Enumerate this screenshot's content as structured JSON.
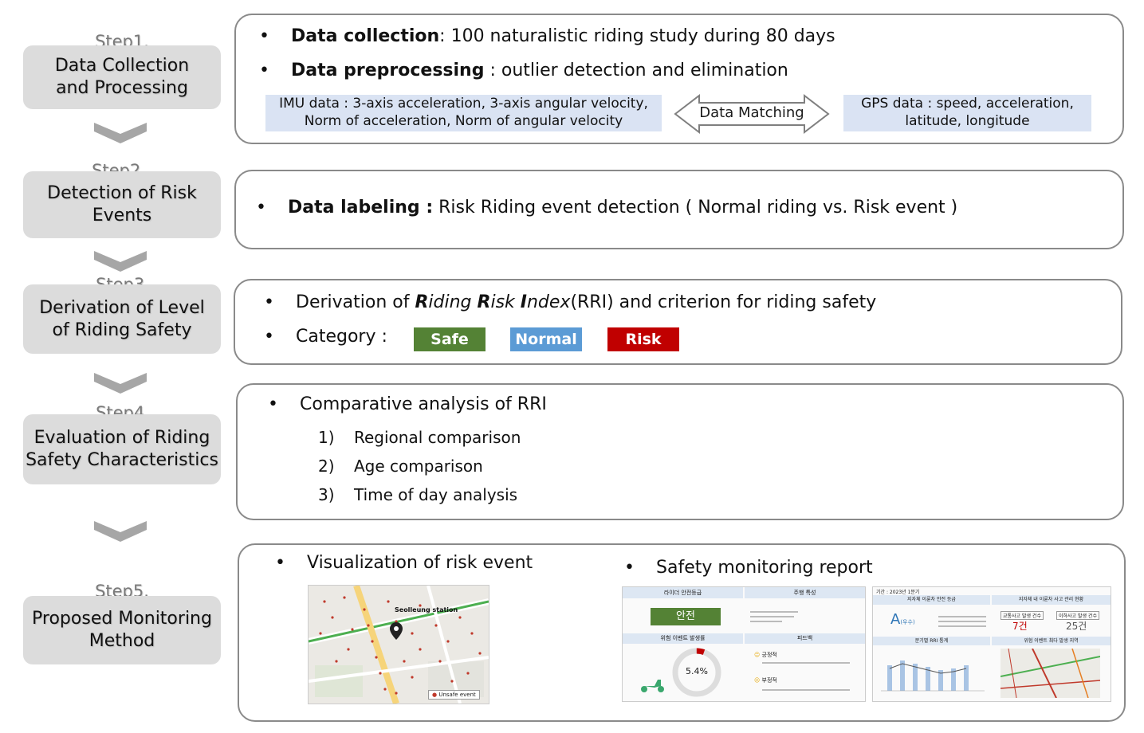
{
  "steps": [
    {
      "label": "Step1.",
      "title_line1": "Data Collection",
      "title_line2": "and Processing"
    },
    {
      "label": "Step2.",
      "title_line1": "Detection of Risk",
      "title_line2": "Events"
    },
    {
      "label": "Step3.",
      "title_line1": "Derivation of Level",
      "title_line2": "of Riding Safety"
    },
    {
      "label": "Step4.",
      "title_line1": "Evaluation of Riding",
      "title_line2": "Safety Characteristics"
    },
    {
      "label": "Step5.",
      "title_line1": "Proposed Monitoring",
      "title_line2": "Method"
    }
  ],
  "panel1": {
    "bullet1_bold": "Data collection",
    "bullet1_rest": ": 100 naturalistic riding study during 80 days",
    "bullet2_bold": "Data preprocessing",
    "bullet2_rest": " : outlier detection and elimination",
    "imu_line1": "IMU data : 3-axis acceleration, 3-axis angular velocity,",
    "imu_line2": "Norm of acceleration, Norm of angular velocity",
    "matching": "Data Matching",
    "gps_line1": "GPS data : speed, acceleration,",
    "gps_line2": "latitude, longitude"
  },
  "panel2": {
    "bullet_bold": "Data labeling :",
    "bullet_rest": " Risk Riding event detection ( Normal riding vs. Risk event )"
  },
  "panel3": {
    "bullet1_pre": "Derivation of ",
    "r1": "R",
    "r1_rest": "iding ",
    "r2": "R",
    "r2_rest": "isk ",
    "r3": "I",
    "r3_rest": "ndex",
    "bullet1_post": "(RRI) and criterion for riding safety",
    "bullet2": "Category  :",
    "categories": [
      {
        "label": "Safe",
        "color": "#548235"
      },
      {
        "label": "Normal",
        "color": "#5b9bd5"
      },
      {
        "label": "Risk",
        "color": "#c00000"
      }
    ]
  },
  "panel4": {
    "bullet": "Comparative analysis of RRI",
    "items": [
      {
        "num": "1)",
        "text": "Regional comparison"
      },
      {
        "num": "2)",
        "text": "Age comparison"
      },
      {
        "num": "3)",
        "text": "Time of day analysis"
      }
    ]
  },
  "panel5": {
    "bullet1": "Visualization of risk event",
    "bullet2": "Safety monitoring report",
    "map_station": "Seolleung station",
    "map_legend": "Unsafe event",
    "report1": {
      "h1": "라이더 안전등급",
      "h2": "주행 특성",
      "grade": "안전",
      "h3": "위험 이벤트 발생률",
      "h4": "피드백",
      "percent": "5.4%",
      "fb1": "긍정적",
      "fb2": "부정적"
    },
    "report2": {
      "period": "기간 : 2023년 1분기",
      "h1": "지자체 이륜차 안전 등급",
      "h2": "지자체 내 이륜차 사고 관리 현황",
      "grade": "A",
      "grade_sub": "(우수)",
      "c1": "교통사고 발생 건수",
      "c2": "이하사고 발생 건수",
      "v1": "7건",
      "v2": "25건",
      "h3": "분기별 RRI 통계",
      "h4": "위험 이벤트 최다 발생 지역"
    }
  }
}
